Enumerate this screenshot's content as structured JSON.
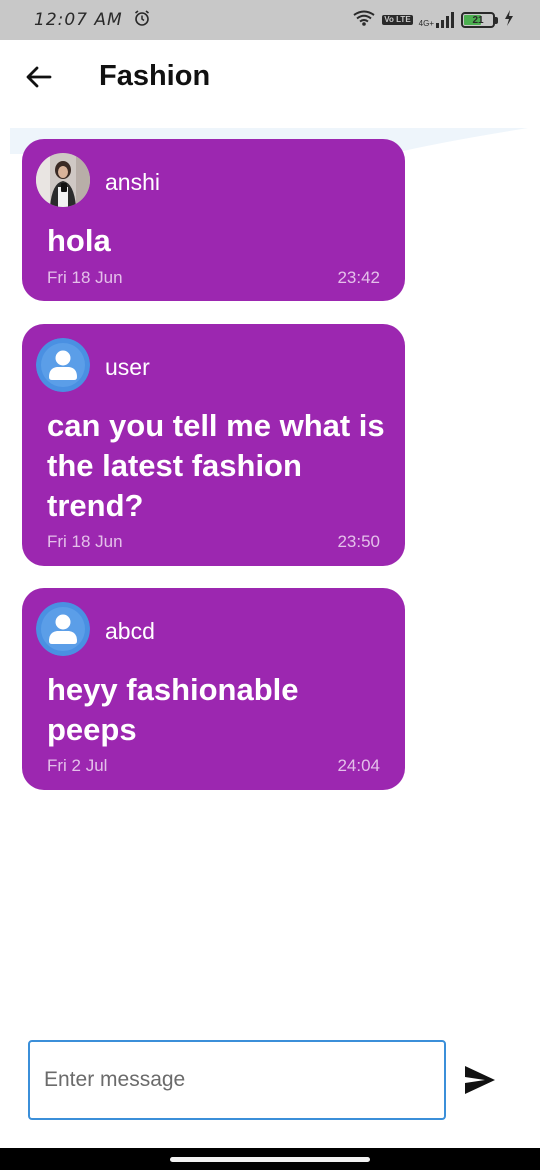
{
  "status_bar": {
    "time": "12:07 AM",
    "volte": "Vo LTE",
    "network": "4G+",
    "battery_level": "21",
    "icons": [
      "alarm-icon",
      "wifi-icon",
      "signal-icon",
      "battery-icon",
      "charging-icon"
    ]
  },
  "header": {
    "title": "Fashion",
    "back_icon": "arrow-left-icon"
  },
  "colors": {
    "bubble": "#9c27b0",
    "input_border": "#3b8fd9",
    "avatar_blue": "#4a90e2"
  },
  "messages": [
    {
      "username": "anshi",
      "avatar": "photo-avatar",
      "text": "hola",
      "date": "Fri 18 Jun",
      "time": "23:42"
    },
    {
      "username": "user",
      "avatar": "default-user-icon",
      "text": "can you tell me what is the latest fashion trend?",
      "date": "Fri 18 Jun",
      "time": "23:50"
    },
    {
      "username": "abcd",
      "avatar": "default-user-icon",
      "text": "heyy fashionable peeps",
      "date": "Fri 2 Jul",
      "time": "24:04"
    }
  ],
  "composer": {
    "placeholder": "Enter message",
    "value": "",
    "send_icon": "send-icon"
  }
}
